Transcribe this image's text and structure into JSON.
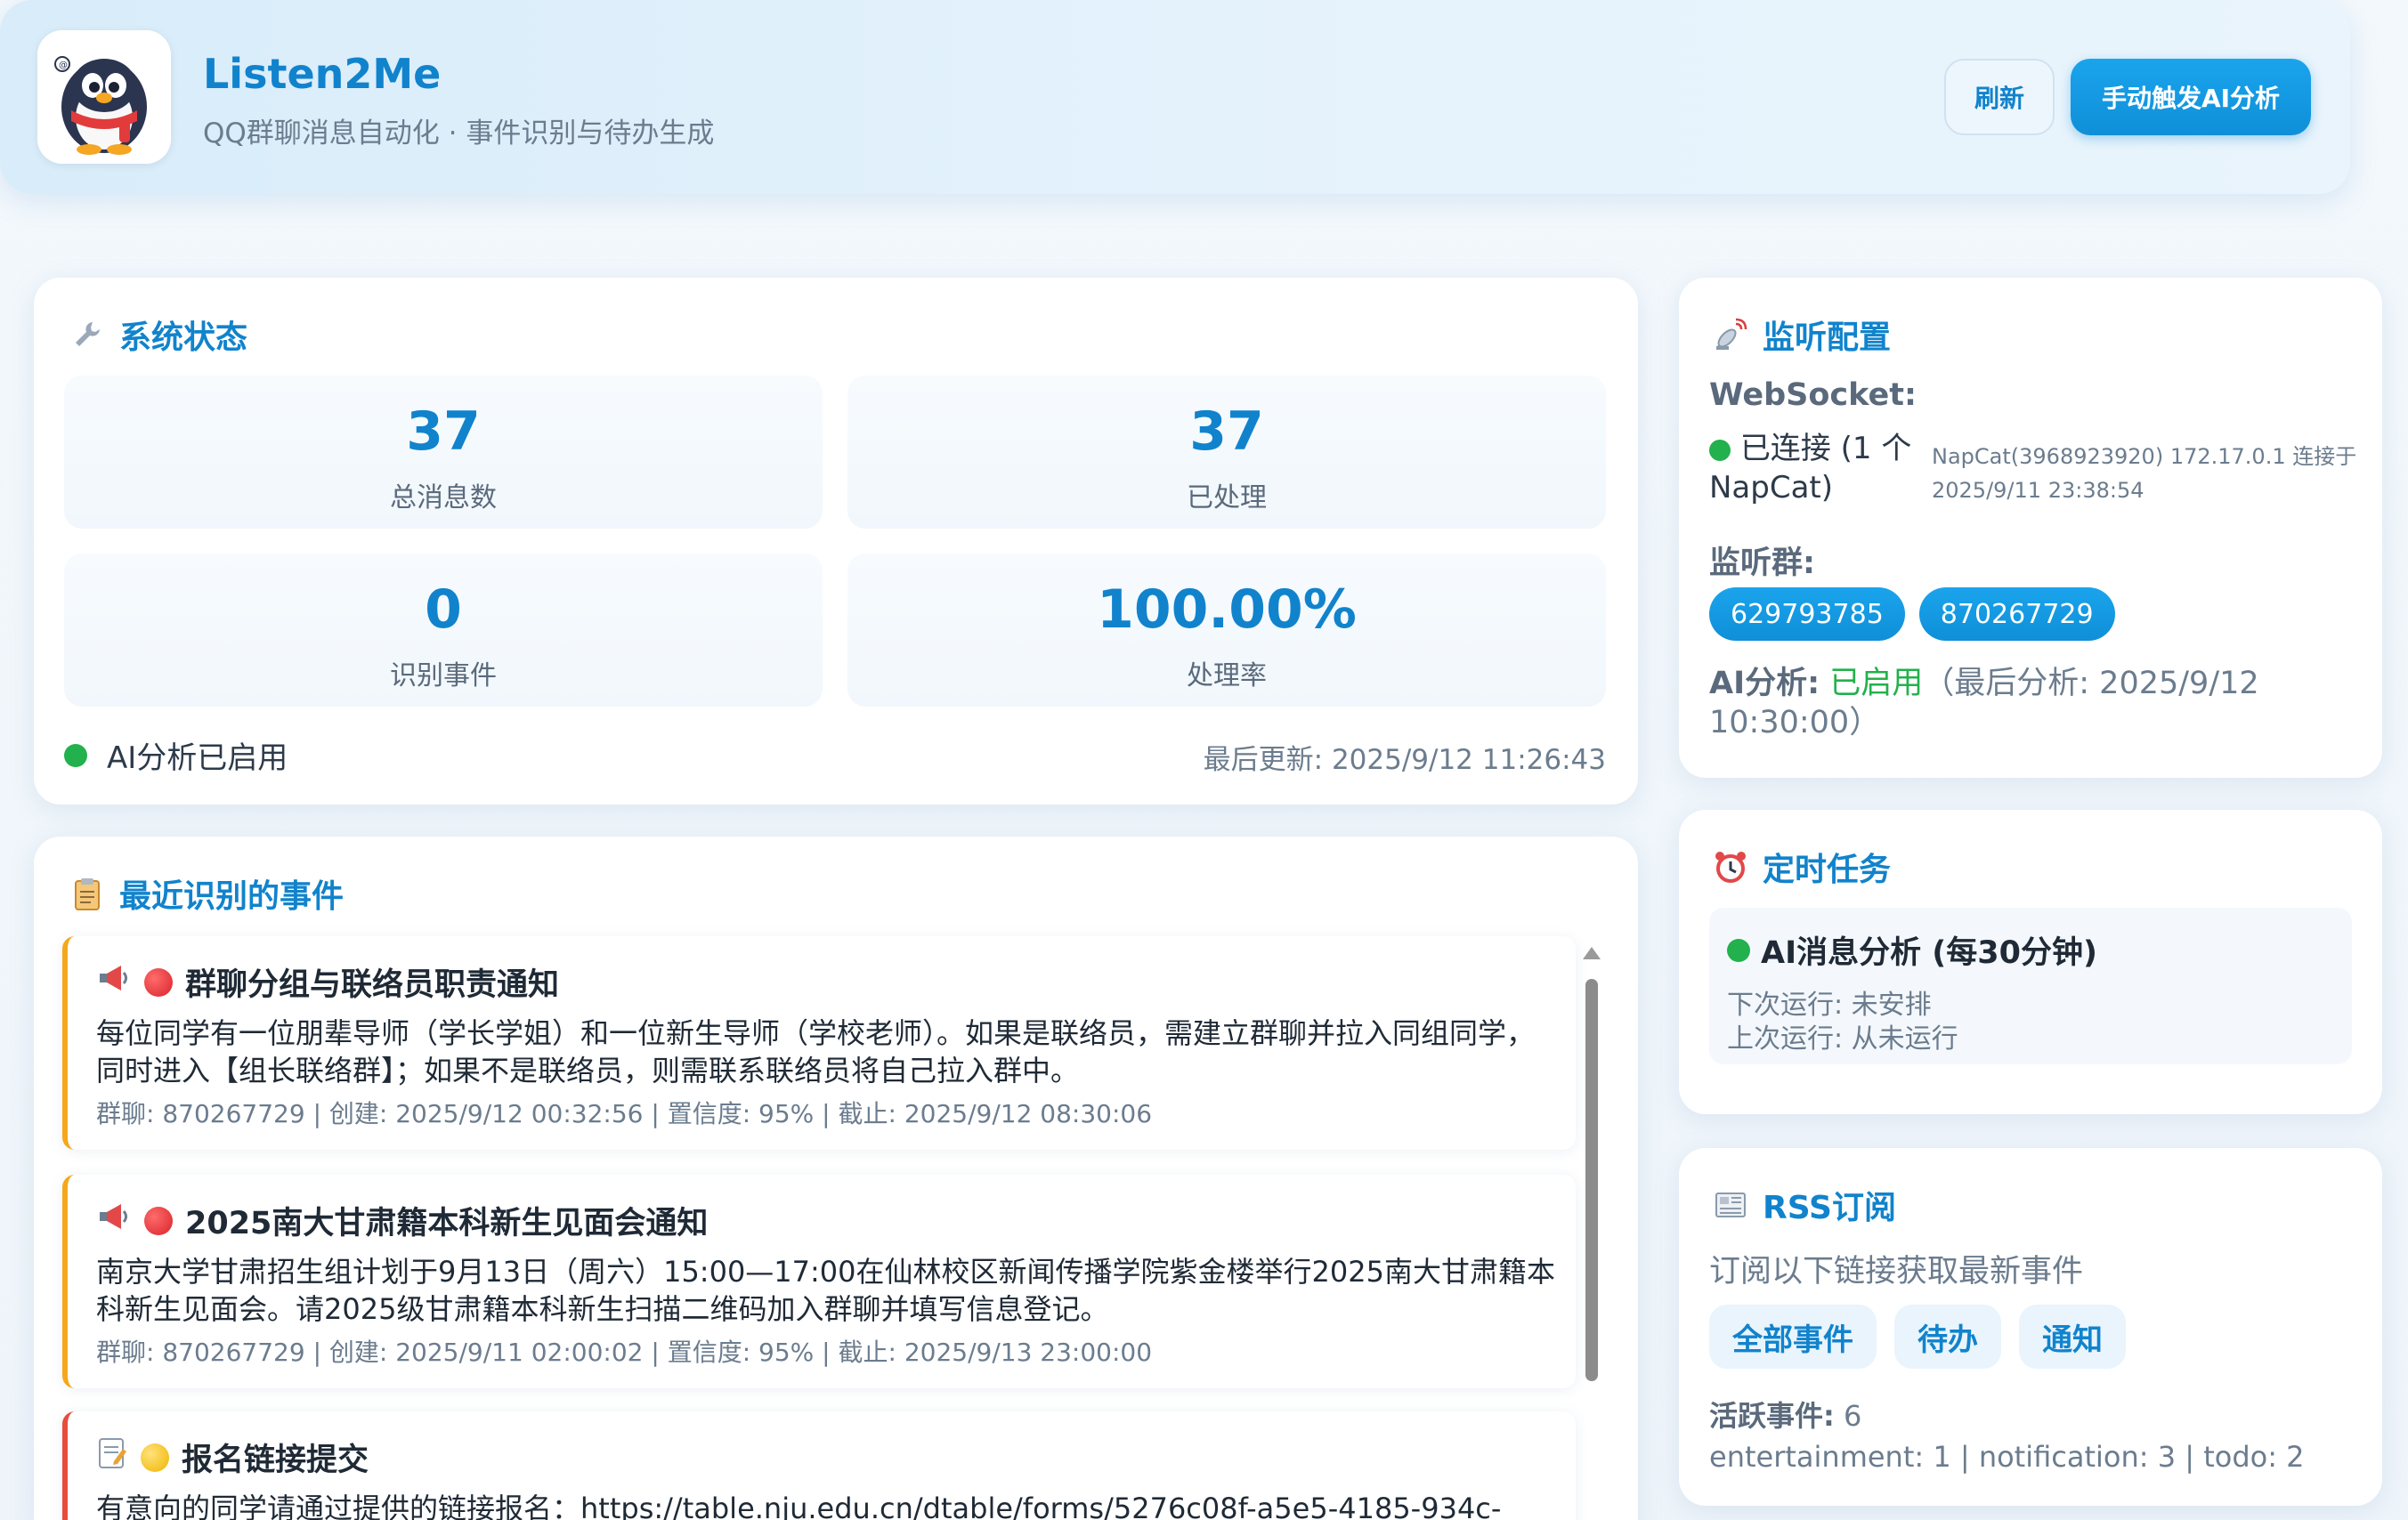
{
  "header": {
    "title": "Listen2Me",
    "subtitle": "QQ群聊消息自动化 · 事件识别与待办生成",
    "refresh_label": "刷新",
    "trigger_label": "手动触发AI分析"
  },
  "status": {
    "title": "系统状态",
    "stats": [
      {
        "value": "37",
        "label": "总消息数"
      },
      {
        "value": "37",
        "label": "已处理"
      },
      {
        "value": "0",
        "label": "识别事件"
      },
      {
        "value": "100.00%",
        "label": "处理率"
      }
    ],
    "ai_text": "AI分析已启用",
    "last_update": "最后更新: 2025/9/12 11:26:43"
  },
  "events": {
    "title": "最近识别的事件",
    "items": [
      {
        "icon": "megaphone-icon",
        "priority": "red",
        "title": "群聊分组与联络员职责通知",
        "desc": "每位同学有一位朋辈导师（学长学姐）和一位新生导师（学校老师）。如果是联络员，需建立群聊并拉入同组同学，同时进入【组长联络群】；如果不是联络员，则需联系联络员将自己拉入群中。",
        "meta": "群聊: 870267729 | 创建: 2025/9/12 00:32:56 | 置信度: 95% | 截止: 2025/9/12 08:30:06"
      },
      {
        "icon": "megaphone-icon",
        "priority": "red",
        "title": "2025南大甘肃籍本科新生见面会通知",
        "desc": "南京大学甘肃招生组计划于9月13日（周六）15:00—17:00在仙林校区新闻传播学院紫金楼举行2025南大甘肃籍本科新生见面会。请2025级甘肃籍本科新生扫描二维码加入群聊并填写信息登记。",
        "meta": "群聊: 870267729 | 创建: 2025/9/11 02:00:02 | 置信度: 95% | 截止: 2025/9/13 23:00:00"
      },
      {
        "icon": "memo-icon",
        "priority": "yellow",
        "title": "报名链接提交",
        "desc": "有意向的同学请通过提供的链接报名：https://table.nju.edu.cn/dtable/forms/5276c08f-a5e5-4185-934c-",
        "meta": ""
      }
    ]
  },
  "monitor": {
    "title": "监听配置",
    "ws_label": "WebSocket:",
    "ws_status": "已连接 (1 个 NapCat)",
    "ws_detail": "NapCat(3968923920) 172.17.0.1 连接于 2025/9/11 23:38:54",
    "groups_label": "监听群:",
    "groups": [
      "629793785",
      "870267729"
    ],
    "ai_label": "AI分析:",
    "ai_state": "已启用",
    "ai_last": "（最后分析: 2025/9/12 10:30:00）"
  },
  "schedule": {
    "title": "定时任务",
    "task_name": "AI消息分析 (每30分钟)",
    "next_run": "下次运行: 未安排",
    "last_run": "上次运行: 从未运行"
  },
  "rss": {
    "title": "RSS订阅",
    "desc": "订阅以下链接获取最新事件",
    "links": [
      "全部事件",
      "待办",
      "通知"
    ],
    "active_label": "活跃事件:",
    "active_count": "6",
    "breakdown": "entertainment: 1 | notification: 3 | todo: 2"
  },
  "colors": {
    "accent": "#1183cc",
    "success": "#22b14c",
    "warning_border": "#f4a81c",
    "danger_border": "#e74c3c"
  }
}
